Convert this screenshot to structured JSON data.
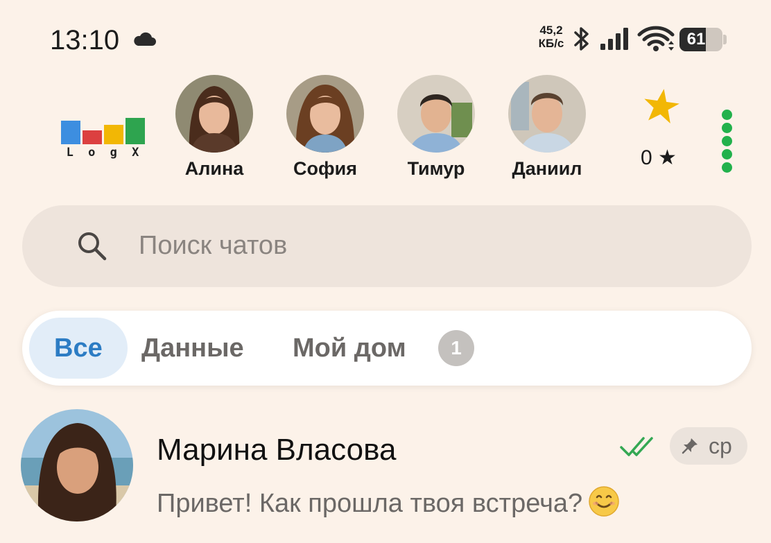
{
  "status_bar": {
    "time": "13:10",
    "net_speed_value": "45,2",
    "net_speed_unit": "КБ/с",
    "battery_level": "61",
    "battery_fraction": 0.61
  },
  "logo": {
    "letters": [
      "L",
      "o",
      "g",
      "X"
    ],
    "colors": [
      "#3d8ee0",
      "#dc4040",
      "#f2b705",
      "#2ea44f"
    ]
  },
  "stories": [
    {
      "name": "Алина"
    },
    {
      "name": "София"
    },
    {
      "name": "Тимур"
    },
    {
      "name": "Даниил"
    }
  ],
  "stars": {
    "count": "0 ★"
  },
  "search": {
    "placeholder": "Поиск чатов"
  },
  "tabs": [
    {
      "label": "Все",
      "active": true
    },
    {
      "label": "Данные"
    },
    {
      "label": "Мой дом",
      "badge": "1"
    }
  ],
  "chats": [
    {
      "name": "Марина Власова",
      "preview": "Привет! Как прошла твоя встреча?",
      "date": "ср",
      "pinned": true,
      "read": true
    }
  ],
  "colors": {
    "background": "#fcf2e9",
    "accent_blue": "#2c7cc4",
    "green": "#22b14c",
    "star": "#f2b705"
  }
}
